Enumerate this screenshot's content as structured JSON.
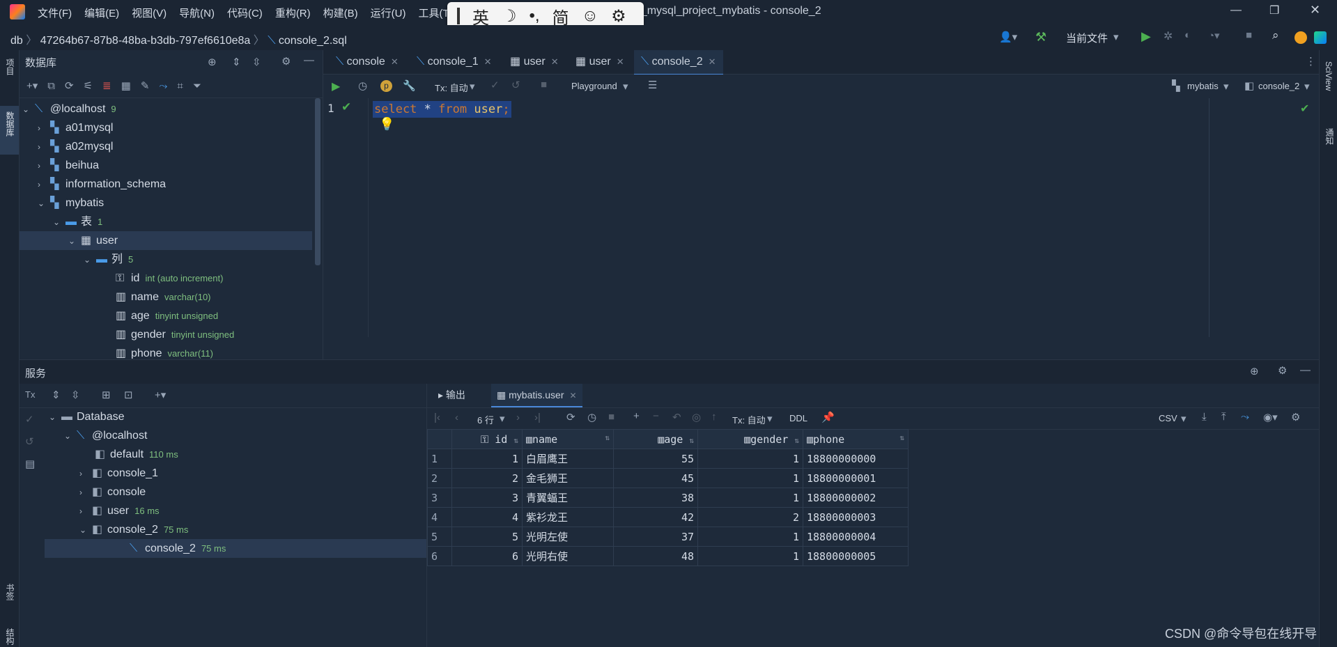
{
  "titlebar": {
    "menus": [
      "文件(F)",
      "编辑(E)",
      "视图(V)",
      "导航(N)",
      "代码(C)",
      "重构(R)",
      "构建(B)",
      "运行(U)",
      "工具(T)"
    ],
    "title": "na_mysql_project_mybatis - console_2",
    "ime": [
      "英",
      "简"
    ]
  },
  "navbar": {
    "crumbs": [
      "db",
      "47264b67-87b8-48ba-b3db-797ef6610e8a",
      "console_2.sql"
    ],
    "run_config": "当前文件"
  },
  "left_strip": {
    "project": "项目",
    "database": "数据库",
    "bookmarks": "书签",
    "structure": "结构"
  },
  "right_strip": {
    "sciview": "SciView",
    "notifications": "通知"
  },
  "db_panel": {
    "title": "数据库",
    "tree": [
      {
        "label": "@localhost",
        "sub": "9"
      },
      {
        "label": "a01mysql",
        "sub": ""
      },
      {
        "label": "a02mysql",
        "sub": ""
      },
      {
        "label": "beihua",
        "sub": ""
      },
      {
        "label": "information_schema",
        "sub": ""
      },
      {
        "label": "mybatis",
        "sub": ""
      },
      {
        "label": "表",
        "sub": "1"
      },
      {
        "label": "user",
        "sub": ""
      },
      {
        "label": "列",
        "sub": "5"
      },
      {
        "label": "id",
        "sub": "int (auto increment)"
      },
      {
        "label": "name",
        "sub": "varchar(10)"
      },
      {
        "label": "age",
        "sub": "tinyint unsigned"
      },
      {
        "label": "gender",
        "sub": "tinyint unsigned"
      },
      {
        "label": "phone",
        "sub": "varchar(11)"
      }
    ]
  },
  "editor": {
    "tabs": [
      "console",
      "console_1",
      "user",
      "user",
      "console_2"
    ],
    "tx": "Tx: 自动",
    "playground": "Playground",
    "schema": "mybatis",
    "session": "console_2",
    "line_number": "1",
    "sql": {
      "kw1": "select",
      "star": "*",
      "kw2": "from",
      "table": "user",
      "semi": ";"
    }
  },
  "services": {
    "title": "服务",
    "tree": [
      {
        "label": "Database",
        "ms": ""
      },
      {
        "label": "@localhost",
        "ms": ""
      },
      {
        "label": "default",
        "ms": "110 ms"
      },
      {
        "label": "console_1",
        "ms": ""
      },
      {
        "label": "console",
        "ms": ""
      },
      {
        "label": "user",
        "ms": "16 ms"
      },
      {
        "label": "console_2",
        "ms": "75 ms"
      },
      {
        "label": "console_2",
        "ms": "75 ms"
      }
    ]
  },
  "results": {
    "tabs": [
      "输出",
      "mybatis.user"
    ],
    "rows_label": "6 行",
    "tx": "Tx: 自动",
    "ddl": "DDL",
    "export": "CSV",
    "columns": [
      "id",
      "name",
      "age",
      "gender",
      "phone"
    ],
    "rows": [
      [
        "1",
        "1",
        "白眉鹰王",
        "55",
        "1",
        "18800000000"
      ],
      [
        "2",
        "2",
        "金毛狮王",
        "45",
        "1",
        "18800000001"
      ],
      [
        "3",
        "3",
        "青翼蝠王",
        "38",
        "1",
        "18800000002"
      ],
      [
        "4",
        "4",
        "紫衫龙王",
        "42",
        "2",
        "18800000003"
      ],
      [
        "5",
        "5",
        "光明左使",
        "37",
        "1",
        "18800000004"
      ],
      [
        "6",
        "6",
        "光明右使",
        "48",
        "1",
        "18800000005"
      ]
    ]
  },
  "watermark": "CSDN @命令导包在线开导"
}
